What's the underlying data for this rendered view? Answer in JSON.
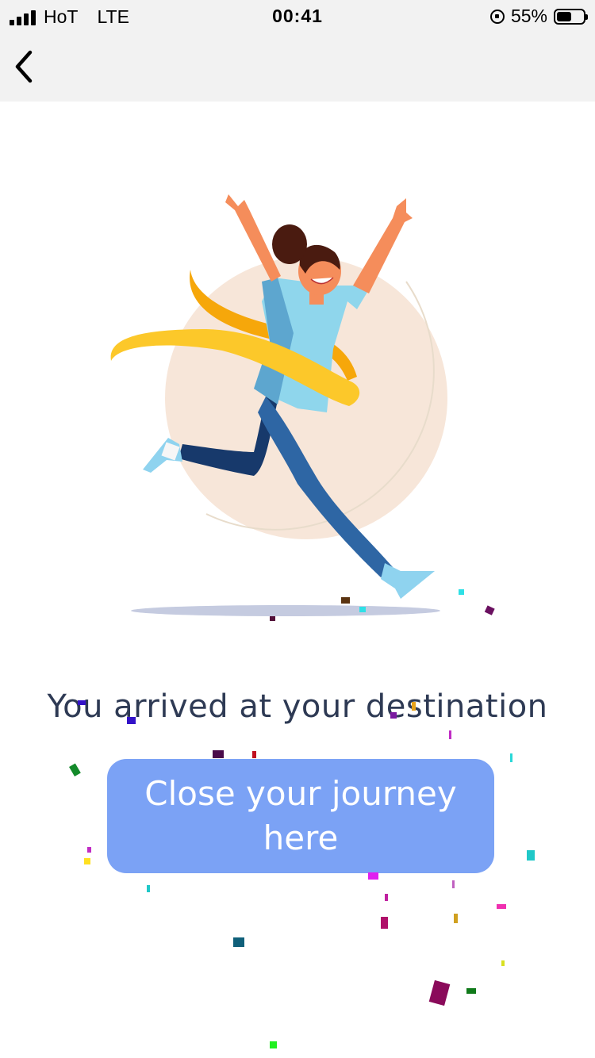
{
  "status_bar": {
    "carrier": "HoT",
    "network": "LTE",
    "time": "00:41",
    "battery": "55%",
    "battery_level": 0.55
  },
  "nav": {
    "back_icon": "chevron-left-icon"
  },
  "main": {
    "message": "You arrived at your destination",
    "close_button_label": "Close your journey here"
  },
  "colors": {
    "button": "#7ba2f5",
    "text": "#2e3a54",
    "header_bg": "#f2f2f2"
  }
}
